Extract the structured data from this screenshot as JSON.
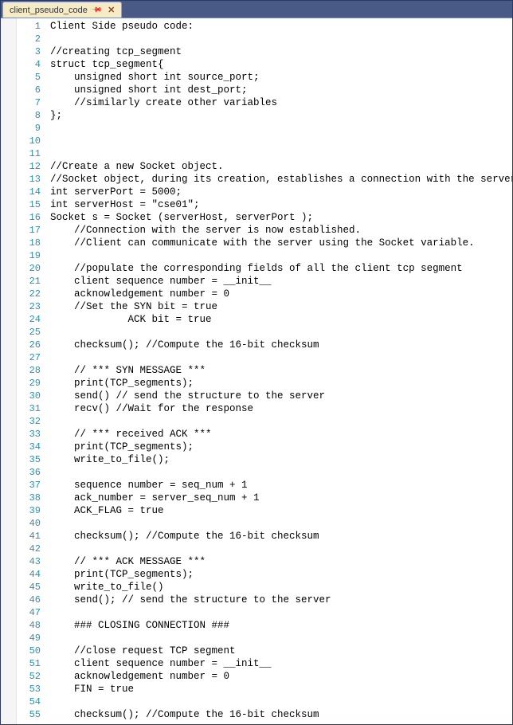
{
  "tab": {
    "title": "client_pseudo_code",
    "pin_glyph": "📌",
    "close_glyph": "✕"
  },
  "code_lines": [
    "Client Side pseudo code:",
    "",
    "//creating tcp_segment",
    "struct tcp_segment{",
    "    unsigned short int source_port;",
    "    unsigned short int dest_port;",
    "    //similarly create other variables",
    "};",
    "",
    "",
    "",
    "//Create a new Socket object.",
    "//Socket object, during its creation, establishes a connection with the server.",
    "int serverPort = 5000;",
    "int serverHost = \"cse01\";",
    "Socket s = Socket (serverHost, serverPort );",
    "    //Connection with the server is now established.",
    "    //Client can communicate with the server using the Socket variable.",
    "",
    "    //populate the corresponding fields of all the client tcp segment",
    "    client sequence number = __init__",
    "    acknowledgement number = 0",
    "    //Set the SYN bit = true",
    "             ACK bit = true",
    "",
    "    checksum(); //Compute the 16-bit checksum",
    "",
    "    // *** SYN MESSAGE ***",
    "    print(TCP_segments);",
    "    send() // send the structure to the server",
    "    recv() //Wait for the response",
    "",
    "    // *** received ACK ***",
    "    print(TCP_segments);",
    "    write_to_file();",
    "",
    "    sequence number = seq_num + 1",
    "    ack_number = server_seq_num + 1",
    "    ACK_FLAG = true",
    "",
    "    checksum(); //Compute the 16-bit checksum",
    "",
    "    // *** ACK MESSAGE ***",
    "    print(TCP_segments);",
    "    write_to_file()",
    "    send(); // send the structure to the server",
    "",
    "    ### CLOSING CONNECTION ###",
    "",
    "    //close request TCP segment",
    "    client sequence number = __init__",
    "    acknowledgement number = 0",
    "    FIN = true",
    "",
    "    checksum(); //Compute the 16-bit checksum"
  ]
}
